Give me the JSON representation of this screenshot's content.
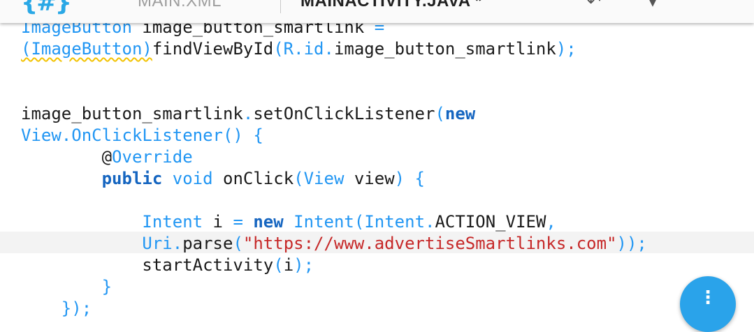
{
  "app": {
    "logo": "{#}"
  },
  "tabs": [
    {
      "label": "MAIN.XML",
      "active": false
    },
    {
      "label": "MAINACTIVITY.JAVA *",
      "active": true
    }
  ],
  "toolbar": {
    "icons": [
      "undo-icon",
      "save-icon"
    ]
  },
  "editor": {
    "highlighted_line_index": 9,
    "lines": [
      {
        "tokens": [
          {
            "text": "ImageButton",
            "c": "ty"
          },
          {
            "text": " image_button_smartlink ",
            "c": "t"
          },
          {
            "text": "=",
            "c": "p"
          }
        ]
      },
      {
        "tokens": [
          {
            "text": "(ImageButton)",
            "c": "ty",
            "warn": true
          },
          {
            "text": "findViewById",
            "c": "t"
          },
          {
            "text": "(R.id.",
            "c": "p"
          },
          {
            "text": "image_button_smartlink",
            "c": "t"
          },
          {
            "text": ");",
            "c": "p"
          }
        ]
      },
      {
        "tokens": []
      },
      {
        "tokens": []
      },
      {
        "tokens": [
          {
            "text": "image_button_smartlink",
            "c": "t"
          },
          {
            "text": ".",
            "c": "p"
          },
          {
            "text": "setOnClickListener",
            "c": "t"
          },
          {
            "text": "(",
            "c": "p"
          },
          {
            "text": "new",
            "c": "kw"
          }
        ]
      },
      {
        "tokens": [
          {
            "text": "View.OnClickListener() {",
            "c": "ty"
          }
        ]
      },
      {
        "tokens": [
          {
            "text": "        ",
            "c": "t"
          },
          {
            "text": "@",
            "c": "t"
          },
          {
            "text": "Override",
            "c": "ann"
          }
        ]
      },
      {
        "tokens": [
          {
            "text": "        ",
            "c": "t"
          },
          {
            "text": "public",
            "c": "kw"
          },
          {
            "text": " ",
            "c": "t"
          },
          {
            "text": "void",
            "c": "kwl"
          },
          {
            "text": " onClick",
            "c": "t"
          },
          {
            "text": "(View",
            "c": "p"
          },
          {
            "text": " view",
            "c": "t"
          },
          {
            "text": ") {",
            "c": "p"
          }
        ]
      },
      {
        "tokens": []
      },
      {
        "tokens": [
          {
            "text": "            ",
            "c": "t"
          },
          {
            "text": "Intent",
            "c": "ty"
          },
          {
            "text": " i ",
            "c": "t"
          },
          {
            "text": "=",
            "c": "p"
          },
          {
            "text": " ",
            "c": "t"
          },
          {
            "text": "new",
            "c": "kw"
          },
          {
            "text": " ",
            "c": "t"
          },
          {
            "text": "Intent(Intent.",
            "c": "ty"
          },
          {
            "text": "ACTION_VIEW",
            "c": "t"
          },
          {
            "text": ",",
            "c": "p"
          }
        ]
      },
      {
        "tokens": [
          {
            "text": "            ",
            "c": "t"
          },
          {
            "text": "Uri.",
            "c": "ty"
          },
          {
            "text": "parse",
            "c": "t"
          },
          {
            "text": "(",
            "c": "p"
          },
          {
            "text": "\"https://www.advertiseSmartlinks.com\"",
            "c": "str"
          },
          {
            "text": "));",
            "c": "p"
          }
        ]
      },
      {
        "tokens": [
          {
            "text": "            ",
            "c": "t"
          },
          {
            "text": "startActivity",
            "c": "t"
          },
          {
            "text": "(",
            "c": "p"
          },
          {
            "text": "i",
            "c": "t"
          },
          {
            "text": ");",
            "c": "p"
          }
        ]
      },
      {
        "tokens": [
          {
            "text": "        ",
            "c": "t"
          },
          {
            "text": "}",
            "c": "p"
          }
        ]
      },
      {
        "tokens": [
          {
            "text": "    ",
            "c": "t"
          },
          {
            "text": "});",
            "c": "p"
          }
        ]
      }
    ]
  },
  "fab": {
    "glyph": "⋮",
    "icon": "more-vert-icon"
  }
}
